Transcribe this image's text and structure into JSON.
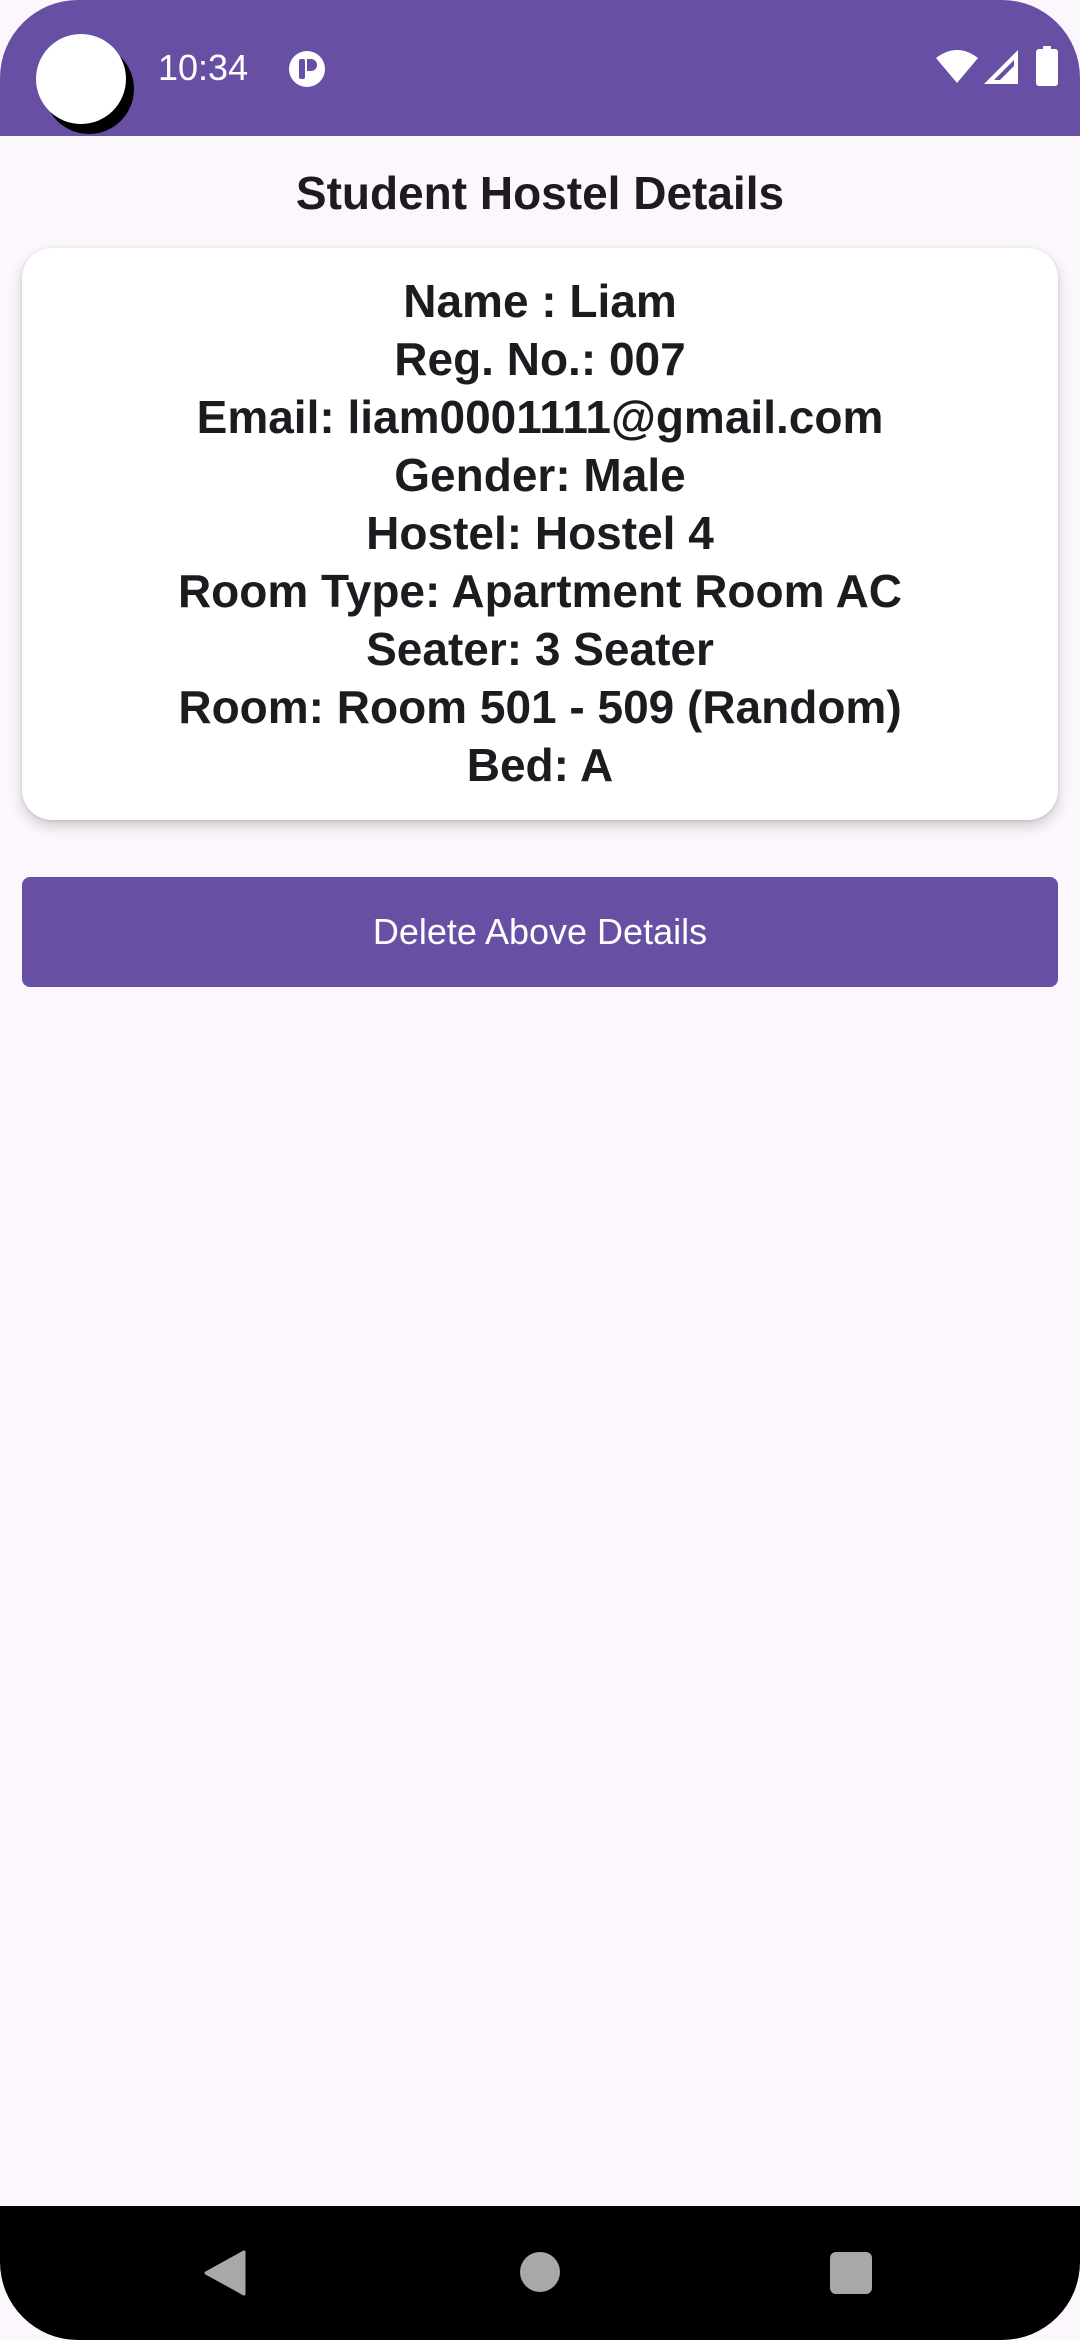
{
  "status_bar": {
    "time": "10:34",
    "icons": [
      "camera-cutout",
      "app-notification-icon",
      "wifi-icon",
      "signal-icon",
      "battery-icon"
    ],
    "background_color": "#6750a4"
  },
  "page": {
    "title": "Student Hostel Details"
  },
  "details": {
    "name": "Name : Liam",
    "reg_no": "Reg. No.: 007",
    "email": "Email: liam0001111@gmail.com",
    "gender": "Gender: Male",
    "hostel": "Hostel: Hostel 4",
    "room_type": "Room Type: Apartment Room AC",
    "seater": "Seater: 3 Seater",
    "room": "Room: Room 501 - 509 (Random)",
    "bed": "Bed: A"
  },
  "actions": {
    "delete_label": "Delete Above Details",
    "accent_color": "#6750a4"
  },
  "nav_bar": {
    "icons": [
      "back-icon",
      "home-icon",
      "recents-icon"
    ]
  }
}
